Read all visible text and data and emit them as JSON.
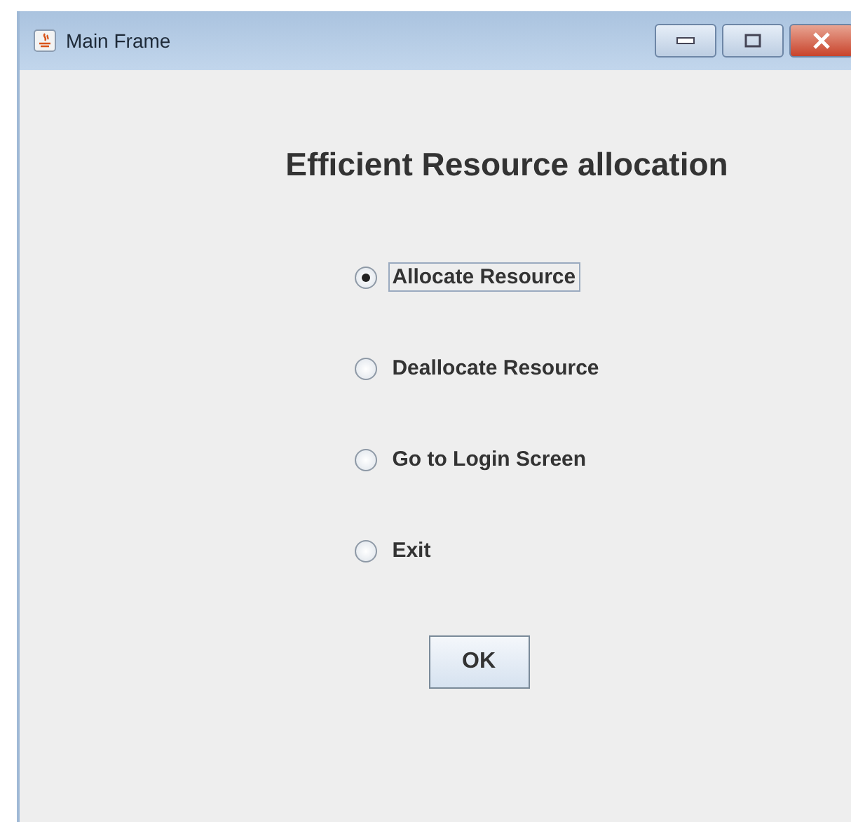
{
  "window": {
    "title": "Main Frame"
  },
  "heading": "Efficient Resource allocation",
  "options": [
    {
      "label": "Allocate Resource",
      "selected": true,
      "focused": true
    },
    {
      "label": "Deallocate Resource",
      "selected": false,
      "focused": false
    },
    {
      "label": "Go to Login Screen",
      "selected": false,
      "focused": false
    },
    {
      "label": "Exit",
      "selected": false,
      "focused": false
    }
  ],
  "ok_button": "OK"
}
